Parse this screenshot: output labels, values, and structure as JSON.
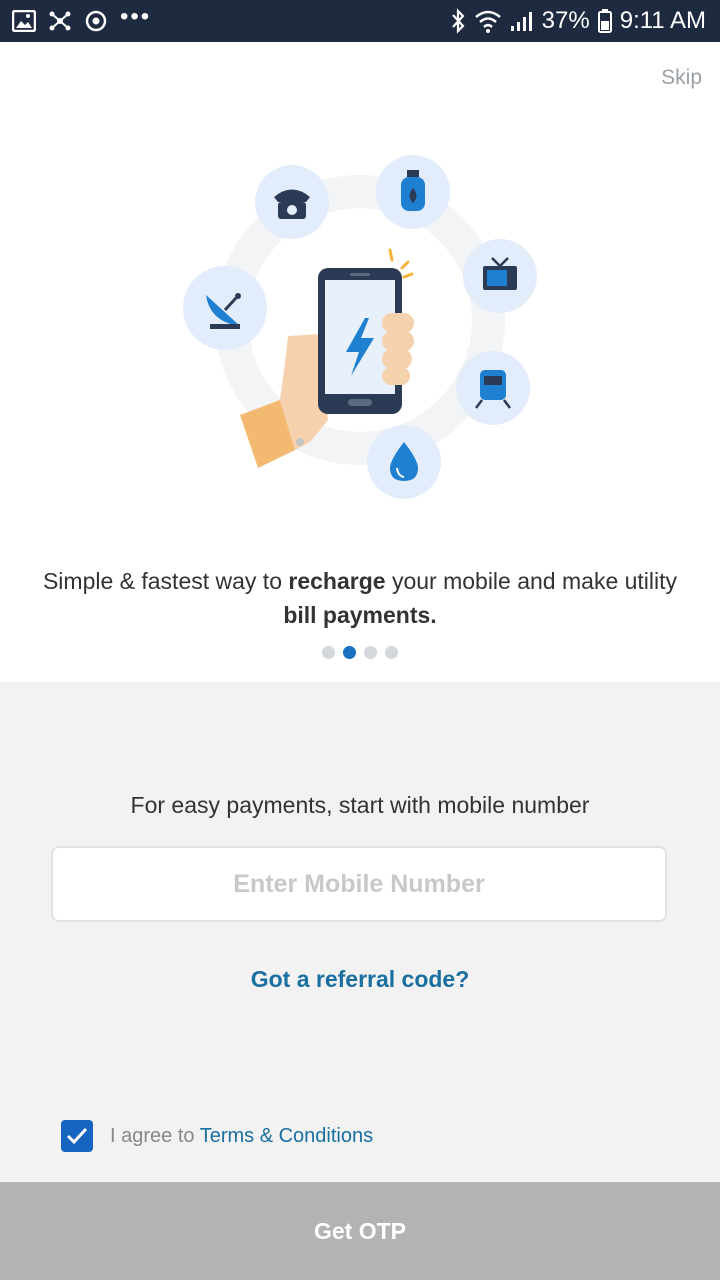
{
  "status_bar": {
    "battery_percent": "37%",
    "time": "9:11 AM",
    "left_icons": [
      "image-icon",
      "network-icon",
      "sync-icon"
    ],
    "more": "•••"
  },
  "skip_label": "Skip",
  "onboarding": {
    "caption_part1": "Simple & fastest way to ",
    "caption_bold1": "recharge",
    "caption_part2": " your mobile and make utility ",
    "caption_bold2": "bill payments.",
    "pages": 4,
    "active_page": 2,
    "icons": [
      "telephone-icon",
      "gas-cylinder-icon",
      "tv-icon",
      "train-icon",
      "water-drop-icon",
      "satellite-dish-icon",
      "phone-in-hand-icon"
    ]
  },
  "form": {
    "prompt": "For easy payments, start with mobile number",
    "mobile_placeholder": "Enter Mobile Number",
    "mobile_value": "",
    "referral_label": "Got a referral code?",
    "agree_text": "I agree to ",
    "terms_label": "Terms & Conditions",
    "agree_checked": true,
    "otp_button": "Get OTP"
  },
  "colors": {
    "status_bar": "#1e2a3f",
    "accent": "#1a6fc0",
    "link": "#1a6fa1",
    "button_disabled": "#b3b3b3",
    "panel_bg": "#f2f2f2"
  }
}
